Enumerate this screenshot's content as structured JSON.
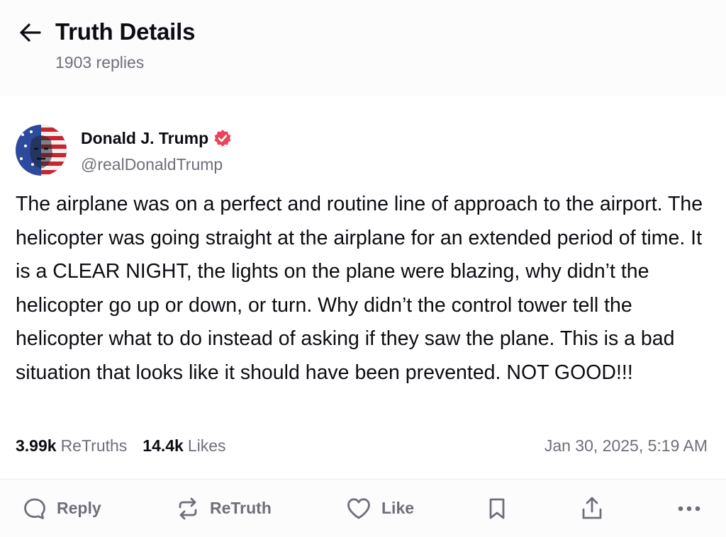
{
  "header": {
    "title": "Truth Details",
    "subtitle": "1903 replies",
    "back_icon": "arrow-left-icon"
  },
  "post": {
    "author": {
      "name": "Donald J. Trump",
      "handle": "@realDonaldTrump",
      "verified_icon": "verified-badge-icon",
      "verified_color": "#e9445a"
    },
    "text": "The airplane was on a perfect and routine line of approach to the airport. The helicopter was going straight at the airplane for an extended period of time. It is a CLEAR NIGHT, the lights on the plane were blazing, why didn’t the helicopter go up or down, or turn. Why didn’t the control tower tell the helicopter what to do instead of asking if they saw the plane. This is a bad situation that looks like it should have been prevented. NOT GOOD!!!",
    "stats": {
      "retruths_count": "3.99k",
      "retruths_label": "ReTruths",
      "likes_count": "14.4k",
      "likes_label": "Likes"
    },
    "timestamp": "Jan 30, 2025, 5:19 AM"
  },
  "actions": {
    "reply_label": "Reply",
    "retruth_label": "ReTruth",
    "like_label": "Like",
    "icons": [
      "reply-icon",
      "retruth-icon",
      "heart-icon",
      "bookmark-icon",
      "share-icon",
      "more-icon"
    ]
  },
  "colors": {
    "text_primary": "#0c0c12",
    "text_secondary": "#6f6f7a",
    "accent": "#e9445a"
  }
}
